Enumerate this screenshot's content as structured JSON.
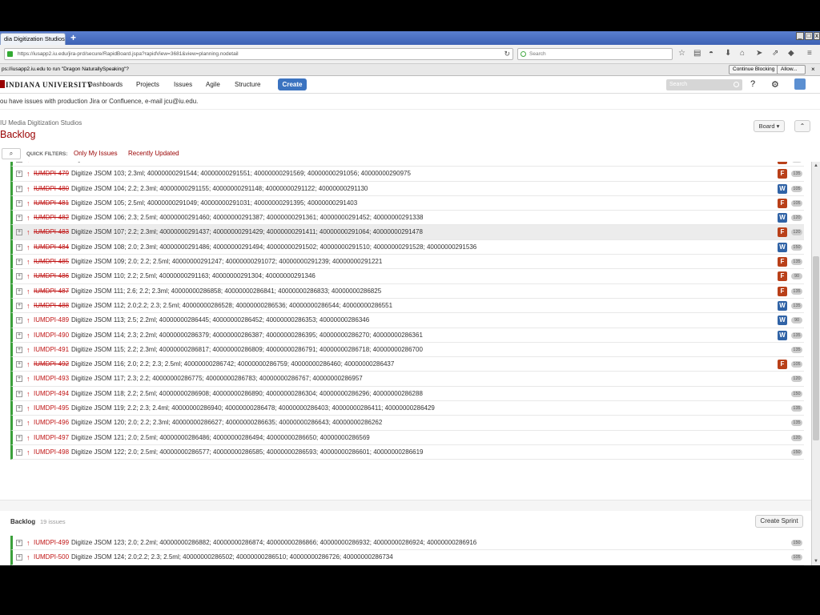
{
  "browser": {
    "tab_title": "dia Digitization Studios -...",
    "new_tab": "+",
    "url": "https://iusapp2.iu.edu/jira-prd/secure/RapidBoard.jspa?rapidView=3681&view=planning.nodetail",
    "search_placeholder": "Search",
    "notification": "ps://iusapp2.iu.edu to run \"Dragon NaturallySpeaking\"?",
    "continue_blocking": "Continue Blocking",
    "allow": "Allow..."
  },
  "jira": {
    "logo": "INDIANA UNIVERSITY",
    "menu": [
      "Dashboards",
      "Projects",
      "Issues",
      "Agile",
      "Structure"
    ],
    "create": "Create",
    "search_placeholder": "Search",
    "announcement": "ou have issues with production Jira or Confluence, e-mail jcu@iu.edu."
  },
  "page": {
    "breadcrumb": "IU Media Digitization Studios",
    "title": "Backlog",
    "board_button": "Board ▾",
    "collapse_button": "⌃",
    "quick_filters_label": "QUICK FILTERS:",
    "quick_filters": [
      "Only My Issues",
      "Recently Updated"
    ]
  },
  "sprint_issues": [
    {
      "key": "IUMDPI-478",
      "summary": "Digitize JSOM 102; 2.2ml; 40000000291037; 40000000291045; 40000000291053; 40000000291061; 40000000291079",
      "done": true,
      "epic": "F",
      "est": "135",
      "cut": true
    },
    {
      "key": "IUMDPI-479",
      "summary": "Digitize JSOM 103; 2.3ml; 40000000291544; 40000000291551; 40000000291569; 40000000291056; 40000000290975",
      "done": true,
      "epic": "F",
      "est": "135"
    },
    {
      "key": "IUMDPI-480",
      "summary": "Digitize JSOM 104; 2.2; 2.3ml; 40000000291155; 40000000291148; 40000000291122; 40000000291130",
      "done": true,
      "epic": "W",
      "est": "105"
    },
    {
      "key": "IUMDPI-481",
      "summary": "Digitize JSOM 105; 2.5ml; 40000000291049; 40000000291031; 40000000291395; 40000000291403",
      "done": true,
      "epic": "F",
      "est": "105"
    },
    {
      "key": "IUMDPI-482",
      "summary": "Digitize JSOM 106; 2.3; 2.5ml; 40000000291460; 40000000291387; 40000000291361; 40000000291452; 40000000291338",
      "done": true,
      "epic": "W",
      "est": "120"
    },
    {
      "key": "IUMDPI-483",
      "summary": "Digitize JSOM 107; 2.2; 2.3ml; 40000000291437; 40000000291429; 40000000291411; 40000000291064; 40000000291478",
      "done": true,
      "epic": "F",
      "est": "120",
      "hl": true
    },
    {
      "key": "IUMDPI-484",
      "summary": "Digitize JSOM 108; 2.0; 2.3ml; 40000000291486; 40000000291494; 40000000291502; 40000000291510; 40000000291528; 40000000291536",
      "done": true,
      "epic": "W",
      "est": "150"
    },
    {
      "key": "IUMDPI-485",
      "summary": "Digitize JSOM 109; 2.0; 2.2; 2.5ml; 40000000291247; 40000000291072; 40000000291239; 40000000291221",
      "done": true,
      "epic": "F",
      "est": "135"
    },
    {
      "key": "IUMDPI-486",
      "summary": "Digitize JSOM 110; 2.2; 2.5ml; 40000000291163; 40000000291304; 40000000291346",
      "done": true,
      "epic": "F",
      "est": "90"
    },
    {
      "key": "IUMDPI-487",
      "summary": "Digitize JSOM 111; 2.6; 2.2; 2.3ml; 40000000286858; 40000000286841; 40000000286833; 40000000286825",
      "done": true,
      "epic": "F",
      "est": "135"
    },
    {
      "key": "IUMDPI-488",
      "summary": "Digitize JSOM 112; 2.0;2.2; 2.3; 2.5ml; 40000000286528; 40000000286536; 40000000286544; 40000000286551",
      "done": true,
      "epic": "W",
      "est": "135"
    },
    {
      "key": "IUMDPI-489",
      "summary": "Digitize JSOM 113; 2.5; 2.2ml; 40000000286445; 40000000286452; 40000000286353; 40000000286346",
      "done": false,
      "epic": "W",
      "est": "90"
    },
    {
      "key": "IUMDPI-490",
      "summary": "Digitize JSOM 114; 2.3; 2.2ml; 40000000286379; 40000000286387; 40000000286395; 40000000286270; 40000000286361",
      "done": false,
      "epic": "W",
      "est": "135"
    },
    {
      "key": "IUMDPI-491",
      "summary": "Digitize JSOM 115; 2.2; 2.3ml; 40000000286817; 40000000286809; 40000000286791; 40000000286718; 40000000286700",
      "done": false,
      "epic": "",
      "est": "135"
    },
    {
      "key": "IUMDPI-492",
      "summary": "Digitize JSOM 116; 2.0; 2.2; 2.3; 2.5ml; 40000000286742; 40000000286759; 40000000286460; 40000000286437",
      "done": true,
      "epic": "F",
      "est": "105"
    },
    {
      "key": "IUMDPI-493",
      "summary": "Digitize JSOM 117; 2.3; 2.2; 40000000286775; 40000000286783; 40000000286767; 40000000286957",
      "done": false,
      "epic": "",
      "est": "120"
    },
    {
      "key": "IUMDPI-494",
      "summary": "Digitize JSOM 118; 2.2; 2.5ml; 40000000286908; 40000000286890; 40000000286304; 40000000286296; 40000000286288",
      "done": false,
      "epic": "",
      "est": "150"
    },
    {
      "key": "IUMDPI-495",
      "summary": "Digitize JSOM 119; 2.2; 2.3; 2.4ml; 40000000286940; 40000000286478; 40000000286403; 40000000286411; 40000000286429",
      "done": false,
      "epic": "",
      "est": "135"
    },
    {
      "key": "IUMDPI-496",
      "summary": "Digitize JSOM 120; 2.0; 2.2; 2.3ml; 40000000286627; 40000000286635; 40000000286643; 40000000286262",
      "done": false,
      "epic": "",
      "est": "135"
    },
    {
      "key": "IUMDPI-497",
      "summary": "Digitize JSOM 121; 2.0; 2.5ml; 40000000286486; 40000000286494; 40000000286650; 40000000286569",
      "done": false,
      "epic": "",
      "est": "120"
    },
    {
      "key": "IUMDPI-498",
      "summary": "Digitize JSOM 122; 2.0; 2.5ml; 40000000286577; 40000000286585; 40000000286593; 40000000286601; 40000000286619",
      "done": false,
      "epic": "",
      "est": "150"
    }
  ],
  "backlog": {
    "title": "Backlog",
    "count": "19 issues",
    "create_sprint": "Create Sprint",
    "issues": [
      {
        "key": "IUMDPI-499",
        "summary": "Digitize JSOM 123; 2.0; 2.2ml; 40000000286882; 40000000286874; 40000000286866; 40000000286932; 40000000286924; 40000000286916",
        "done": false,
        "epic": "",
        "est": "150"
      },
      {
        "key": "IUMDPI-500",
        "summary": "Digitize JSOM 124; 2.0;2.2; 2.3; 2.5ml; 40000000286502; 40000000286510; 40000000286726; 40000000286734",
        "done": false,
        "epic": "",
        "est": "105"
      },
      {
        "key": "IUMDPI-501",
        "summary": "Digitize JSOM 125; 2.0; 2.2; 2.5; 2.6ml; 40000000286676; 40000000286668; 40000000286338; 40000000286320; 40000000286312",
        "done": false,
        "epic": "",
        "est": "135"
      },
      {
        "key": "IUMDPI-502",
        "summary": "Digitize JSOM 126; 2.2; 2.3; 2.6ml; 40000000286692; 40000000286684",
        "done": false,
        "epic": "",
        "est": "90"
      }
    ]
  },
  "colors": {
    "accent_red": "#990000",
    "link_red": "#c01414",
    "epic_f": "#b94019",
    "epic_w": "#3063a6",
    "status_green": "#3ba03b",
    "create_blue": "#3b73c0"
  }
}
